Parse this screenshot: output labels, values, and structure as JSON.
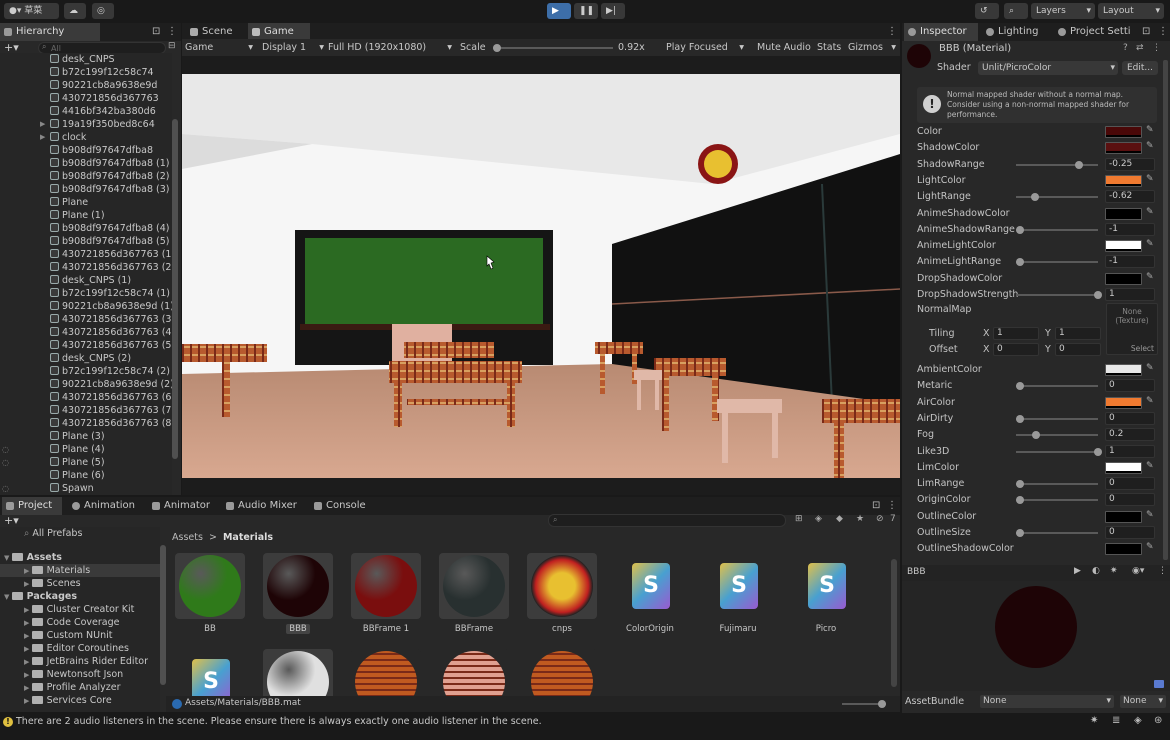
{
  "toolbar": {
    "account": "草菜",
    "play_icon": "play-icon",
    "pause_icon": "pause-icon",
    "step_icon": "step-icon",
    "layers": "Layers",
    "layout": "Layout"
  },
  "hierarchy": {
    "tab": "Hierarchy",
    "search_placeholder": "All",
    "items": [
      {
        "label": "desk_CNPS"
      },
      {
        "label": "b72c199f12c58c74"
      },
      {
        "label": "90221cb8a9638e9d"
      },
      {
        "label": "430721856d367763"
      },
      {
        "label": "4416bf342ba380d6"
      },
      {
        "label": "19a19f350bed8c64"
      },
      {
        "label": "clock"
      },
      {
        "label": "b908df97647dfba8"
      },
      {
        "label": "b908df97647dfba8 (1)"
      },
      {
        "label": "b908df97647dfba8 (2)"
      },
      {
        "label": "b908df97647dfba8 (3)"
      },
      {
        "label": "Plane"
      },
      {
        "label": "Plane (1)"
      },
      {
        "label": "b908df97647dfba8 (4)"
      },
      {
        "label": "b908df97647dfba8 (5)"
      },
      {
        "label": "430721856d367763 (1"
      },
      {
        "label": "430721856d367763 (2"
      },
      {
        "label": "desk_CNPS (1)"
      },
      {
        "label": "b72c199f12c58c74 (1)"
      },
      {
        "label": "90221cb8a9638e9d (1)"
      },
      {
        "label": "430721856d367763 (3"
      },
      {
        "label": "430721856d367763 (4"
      },
      {
        "label": "430721856d367763 (5"
      },
      {
        "label": "desk_CNPS (2)"
      },
      {
        "label": "b72c199f12c58c74 (2)"
      },
      {
        "label": "90221cb8a9638e9d (2)"
      },
      {
        "label": "430721856d367763 (6"
      },
      {
        "label": "430721856d367763 (7"
      },
      {
        "label": "430721856d367763 (8"
      },
      {
        "label": "Plane (3)"
      },
      {
        "label": "Plane (4)"
      },
      {
        "label": "Plane (5)"
      },
      {
        "label": "Plane (6)"
      },
      {
        "label": "Spawn"
      }
    ]
  },
  "center": {
    "tabs": {
      "scene": "Scene",
      "game": "Game"
    },
    "game_bar": {
      "mode": "Game",
      "display": "Display 1",
      "resolution": "Full HD (1920x1080)",
      "scale_label": "Scale",
      "scale_value": "0.92x",
      "play_focused": "Play Focused",
      "mute_audio": "Mute Audio",
      "stats": "Stats",
      "gizmos": "Gizmos"
    }
  },
  "inspector": {
    "tabs": {
      "inspector": "Inspector",
      "lighting": "Lighting",
      "project_settings": "Project Setti"
    },
    "material_name": "BBB (Material)",
    "shader_label": "Shader",
    "shader_value": "Unlit/PicroColor",
    "edit_button": "Edit...",
    "warning": "Normal mapped shader without a normal map. Consider using a non-normal mapped shader for performance.",
    "properties": [
      {
        "label": "Color",
        "kind": "color",
        "color": "#4a0808"
      },
      {
        "label": "ShadowColor",
        "kind": "color",
        "color": "#5a1010"
      },
      {
        "label": "ShadowRange",
        "kind": "slider",
        "value": "-0.25",
        "level": 0.75
      },
      {
        "label": "LightColor",
        "kind": "color",
        "color": "#f07a30"
      },
      {
        "label": "LightRange",
        "kind": "slider",
        "value": "-0.62",
        "level": 0.19
      },
      {
        "label": "AnimeShadowColor",
        "kind": "color",
        "color": "#000000"
      },
      {
        "label": "AnimeShadowRange",
        "kind": "slider",
        "value": "-1",
        "level": 0
      },
      {
        "label": "AnimeLightColor",
        "kind": "color",
        "color": "#ffffff"
      },
      {
        "label": "AnimeLightRange",
        "kind": "slider",
        "value": "-1",
        "level": 0
      },
      {
        "label": "DropShadowColor",
        "kind": "color",
        "color": "#000000"
      },
      {
        "label": "DropShadowStrength",
        "kind": "slider",
        "value": "1",
        "level": 1
      }
    ],
    "normal_map": {
      "label": "NormalMap",
      "tiling_label": "Tiling",
      "offset_label": "Offset",
      "x_label": "X",
      "y_label": "Y",
      "tiling_x": "1",
      "tiling_y": "1",
      "offset_x": "0",
      "offset_y": "0",
      "texture_text": "None\n(Texture)",
      "select_label": "Select"
    },
    "properties2": [
      {
        "label": "AmbientColor",
        "kind": "color",
        "color": "#e8e8e8"
      },
      {
        "label": "Metaric",
        "kind": "slider",
        "value": "0",
        "level": 0
      },
      {
        "label": "AirColor",
        "kind": "color",
        "color": "#f07a30"
      },
      {
        "label": "AirDirty",
        "kind": "slider",
        "value": "0",
        "level": 0
      },
      {
        "label": "Fog",
        "kind": "slider",
        "value": "0.2",
        "level": 0.2
      },
      {
        "label": "Like3D",
        "kind": "slider",
        "value": "1",
        "level": 1
      },
      {
        "label": "LimColor",
        "kind": "color",
        "color": "#ffffff"
      },
      {
        "label": "LimRange",
        "kind": "slider",
        "value": "0",
        "level": 0
      },
      {
        "label": "OriginColor",
        "kind": "slider",
        "value": "0",
        "level": 0
      },
      {
        "label": "OutlineColor",
        "kind": "color",
        "color": "#000000"
      },
      {
        "label": "OutlineSize",
        "kind": "slider",
        "value": "0",
        "level": 0
      },
      {
        "label": "OutlineShadowColor",
        "kind": "color",
        "color": "#000000"
      }
    ],
    "preview_name": "BBB",
    "assetbundle_label": "AssetBundle",
    "assetbundle_value": "None",
    "assetbundle_variant": "None"
  },
  "project": {
    "tabs": {
      "project": "Project",
      "animation": "Animation",
      "animator": "Animator",
      "audio_mixer": "Audio Mixer",
      "console": "Console"
    },
    "all_prefabs": "All Prefabs",
    "breadcrumb": {
      "root": "Assets",
      "sep": ">",
      "current": "Materials"
    },
    "hidden_count": "7",
    "tree": [
      {
        "label": "Assets",
        "level": 0,
        "bold": true
      },
      {
        "label": "Materials",
        "level": 1,
        "selected": true
      },
      {
        "label": "Scenes",
        "level": 1
      },
      {
        "label": "Packages",
        "level": 0,
        "bold": true
      },
      {
        "label": "Cluster Creator Kit",
        "level": 1
      },
      {
        "label": "Code Coverage",
        "level": 1
      },
      {
        "label": "Custom NUnit",
        "level": 1
      },
      {
        "label": "Editor Coroutines",
        "level": 1
      },
      {
        "label": "JetBrains Rider Editor",
        "level": 1
      },
      {
        "label": "Newtonsoft Json",
        "level": 1
      },
      {
        "label": "Profile Analyzer",
        "level": 1
      },
      {
        "label": "Services Core",
        "level": 1
      }
    ],
    "assets": [
      {
        "label": "BB",
        "kind": "sphere",
        "color": "#2f7a1a"
      },
      {
        "label": "BBB",
        "kind": "sphere",
        "color": "#1e0406",
        "selected": true
      },
      {
        "label": "BBFrame 1",
        "kind": "sphere",
        "color": "#7a0e0e"
      },
      {
        "label": "BBFrame",
        "kind": "sphere",
        "color": "#283030"
      },
      {
        "label": "cnps",
        "kind": "logo",
        "color": "#c02020"
      },
      {
        "label": "ColorOrigin",
        "kind": "shader"
      },
      {
        "label": "Fujimaru",
        "kind": "shader"
      },
      {
        "label": "Picro",
        "kind": "shader"
      }
    ],
    "assets_row2": [
      {
        "kind": "shader"
      },
      {
        "kind": "sphere",
        "color": "#e0e0e0"
      },
      {
        "kind": "plaid",
        "color": "#c05a20"
      },
      {
        "kind": "plaid",
        "color": "#e0a090"
      },
      {
        "kind": "plaid",
        "color": "#c05a20"
      }
    ],
    "path": "Assets/Materials/BBB.mat"
  },
  "status": {
    "message": "There are 2 audio listeners in the scene. Please ensure there is always exactly one audio listener in the scene."
  }
}
